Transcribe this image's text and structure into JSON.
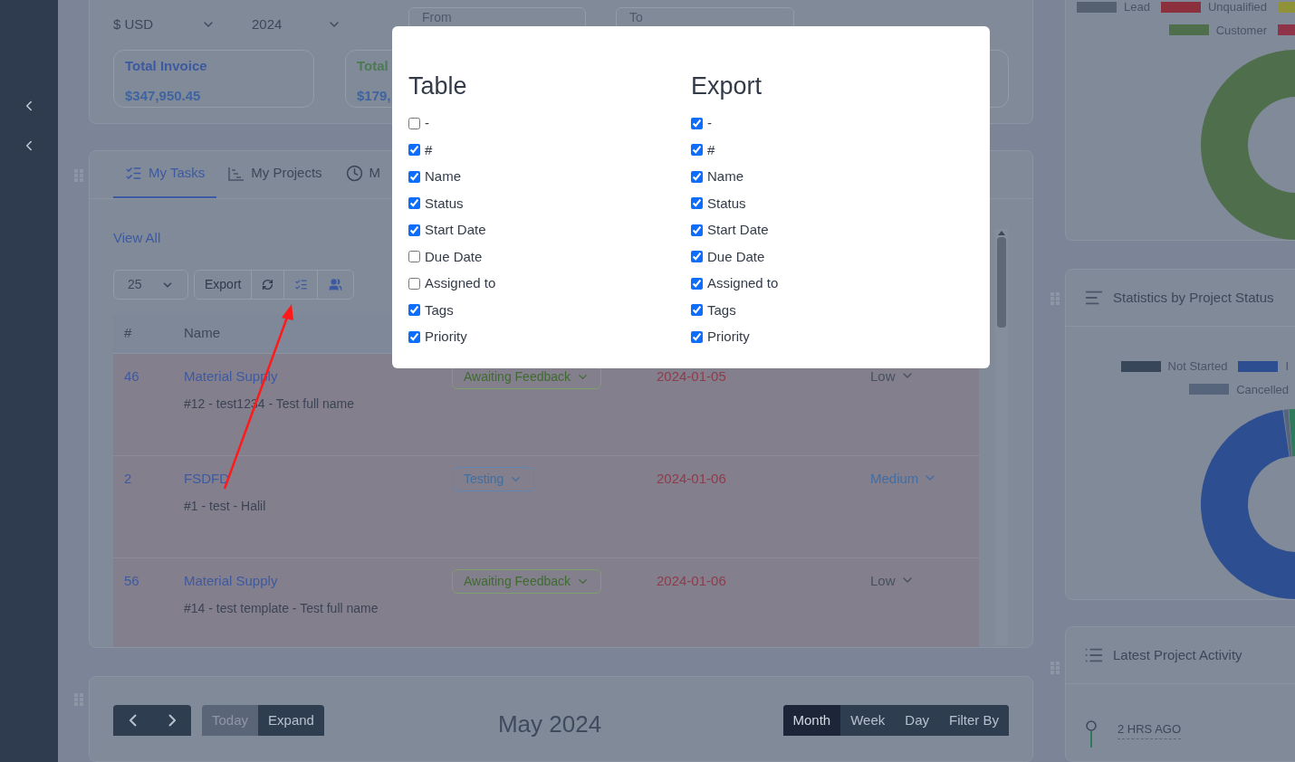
{
  "filters": {
    "currency": "$ USD",
    "year": "2024",
    "from": {
      "placeholder": "From"
    },
    "to": {
      "placeholder": "To"
    }
  },
  "stat_cards": [
    {
      "label": "Total Invoice",
      "value": "$347,950.45",
      "color": "#3d5aa0"
    },
    {
      "label": "Total",
      "value": "$179,",
      "color": "#4d7a52"
    }
  ],
  "tabs": [
    {
      "label": "My Tasks",
      "kind": "tasks",
      "selected": true
    },
    {
      "label": "My Projects",
      "kind": "projects",
      "selected": false
    },
    {
      "label": "M",
      "kind": "clock",
      "selected": false
    }
  ],
  "view_all": "View All",
  "toolbar": {
    "page_size": "25",
    "export": "Export"
  },
  "table": {
    "columns": [
      "#",
      "Name"
    ],
    "rows": [
      {
        "id": "46",
        "name": "Material Supply",
        "subtitle": "#12 - test1234 - Test full name",
        "status": {
          "label": "Awaiting Feedback",
          "kind": "awaiting"
        },
        "date": "2024-01-05",
        "priority": {
          "label": "Low",
          "kind": "low"
        }
      },
      {
        "id": "2",
        "name": "FSDFD",
        "subtitle": "#1 - test - Halil",
        "status": {
          "label": "Testing",
          "kind": "testing"
        },
        "date": "2024-01-06",
        "priority": {
          "label": "Medium",
          "kind": "medium"
        }
      },
      {
        "id": "56",
        "name": "Material Supply",
        "subtitle": "#14 - test template - Test full name",
        "status": {
          "label": "Awaiting Feedback",
          "kind": "awaiting"
        },
        "date": "2024-01-06",
        "priority": {
          "label": "Low",
          "kind": "low"
        }
      }
    ]
  },
  "calendar": {
    "today": "Today",
    "expand": "Expand",
    "title": "May 2024",
    "views": [
      {
        "label": "Month",
        "selected": true
      },
      {
        "label": "Week",
        "selected": false
      },
      {
        "label": "Day",
        "selected": false
      },
      {
        "label": "Filter By",
        "selected": false
      }
    ]
  },
  "leads_chart": {
    "legend": [
      [
        {
          "label": "Lead",
          "color": "#556170"
        },
        {
          "label": "Unqualified",
          "color": "#8b303c"
        },
        {
          "color": "#8f9236"
        }
      ],
      [
        {
          "label": "Customer",
          "color": "#4f6e4b"
        },
        {
          "color": "#8f3348"
        }
      ]
    ]
  },
  "project_status": {
    "title": "Statistics by Project Status",
    "legend": [
      [
        {
          "label": "Not Started",
          "color": "#374659"
        },
        {
          "label": "I",
          "color": "#2d4f91"
        }
      ],
      [
        {
          "label": "Cancelled",
          "color": "#56657c"
        }
      ]
    ]
  },
  "activity": {
    "title": "Latest Project Activity",
    "items": [
      {
        "time": "2 HRS AGO"
      }
    ]
  },
  "columns_dialog": {
    "table": {
      "title": "Table",
      "columns": [
        {
          "label": "-",
          "checked": false
        },
        {
          "label": "#",
          "checked": true
        },
        {
          "label": "Name",
          "checked": true
        },
        {
          "label": "Status",
          "checked": true
        },
        {
          "label": "Start Date",
          "checked": true
        },
        {
          "label": "Due Date",
          "checked": false
        },
        {
          "label": "Assigned to",
          "checked": false
        },
        {
          "label": "Tags",
          "checked": true
        },
        {
          "label": "Priority",
          "checked": true
        }
      ]
    },
    "export": {
      "title": "Export",
      "columns": [
        {
          "label": "-",
          "checked": true
        },
        {
          "label": "#",
          "checked": true
        },
        {
          "label": "Name",
          "checked": true
        },
        {
          "label": "Status",
          "checked": true
        },
        {
          "label": "Start Date",
          "checked": true
        },
        {
          "label": "Due Date",
          "checked": true
        },
        {
          "label": "Assigned to",
          "checked": true
        },
        {
          "label": "Tags",
          "checked": true
        },
        {
          "label": "Priority",
          "checked": true
        }
      ]
    }
  }
}
